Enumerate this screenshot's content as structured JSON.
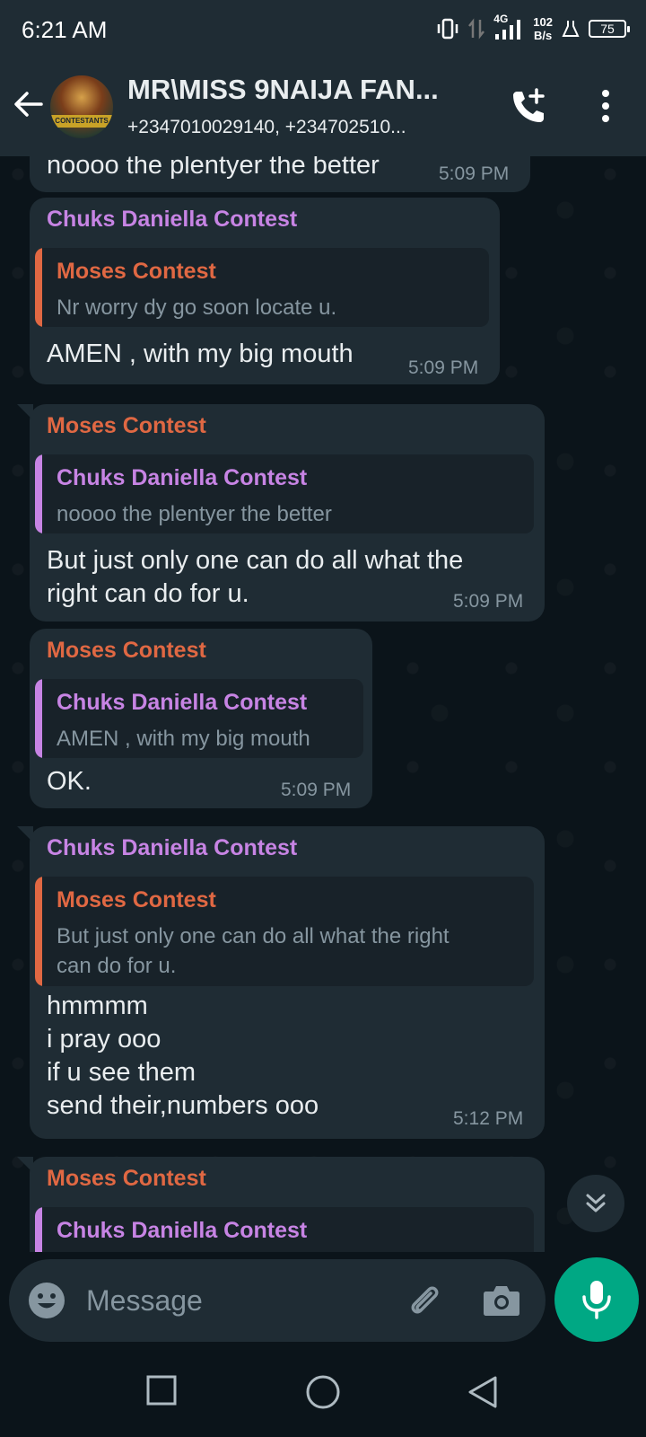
{
  "status_bar": {
    "time": "6:21 AM",
    "network": "4G",
    "speed_value": "102",
    "speed_unit": "B/s",
    "battery": "75"
  },
  "header": {
    "title": "MR\\MISS 9NAIJA FAN...",
    "subtitle": "+2347010029140, +234702510...",
    "avatar_text": "CONTESTANTS"
  },
  "colors": {
    "purple_sender": "#c784e4",
    "orange_sender": "#e06843",
    "bubble": "#1f2c34",
    "accent": "#00a884"
  },
  "messages": [
    {
      "text": "noooo the plentyer the better",
      "time": "5:09 PM"
    },
    {
      "sender": "Chuks Daniella Contest",
      "quote_sender": "Moses Contest",
      "quote_text": "Nr worry dy go soon locate u.",
      "text": "AMEN , with my big mouth",
      "time": "5:09 PM"
    },
    {
      "sender": "Moses Contest",
      "quote_sender": "Chuks Daniella Contest",
      "quote_text": "noooo the plentyer the better",
      "text": "But just only one can do all what the\nright can do for u.",
      "time": "5:09 PM"
    },
    {
      "sender": "Moses Contest",
      "quote_sender": "Chuks Daniella Contest",
      "quote_text": "AMEN , with my big mouth",
      "text": "OK.",
      "time": "5:09 PM"
    },
    {
      "sender": "Chuks Daniella Contest",
      "quote_sender": "Moses Contest",
      "quote_text": "But just only one can do all what the right\ncan do for u.",
      "text": "hmmmm\ni pray ooo\nif u see them\nsend their,numbers ooo",
      "time": "5:12 PM"
    },
    {
      "sender": "Moses Contest",
      "quote_sender": "Chuks Daniella Contest"
    }
  ],
  "composer": {
    "placeholder": "Message"
  }
}
